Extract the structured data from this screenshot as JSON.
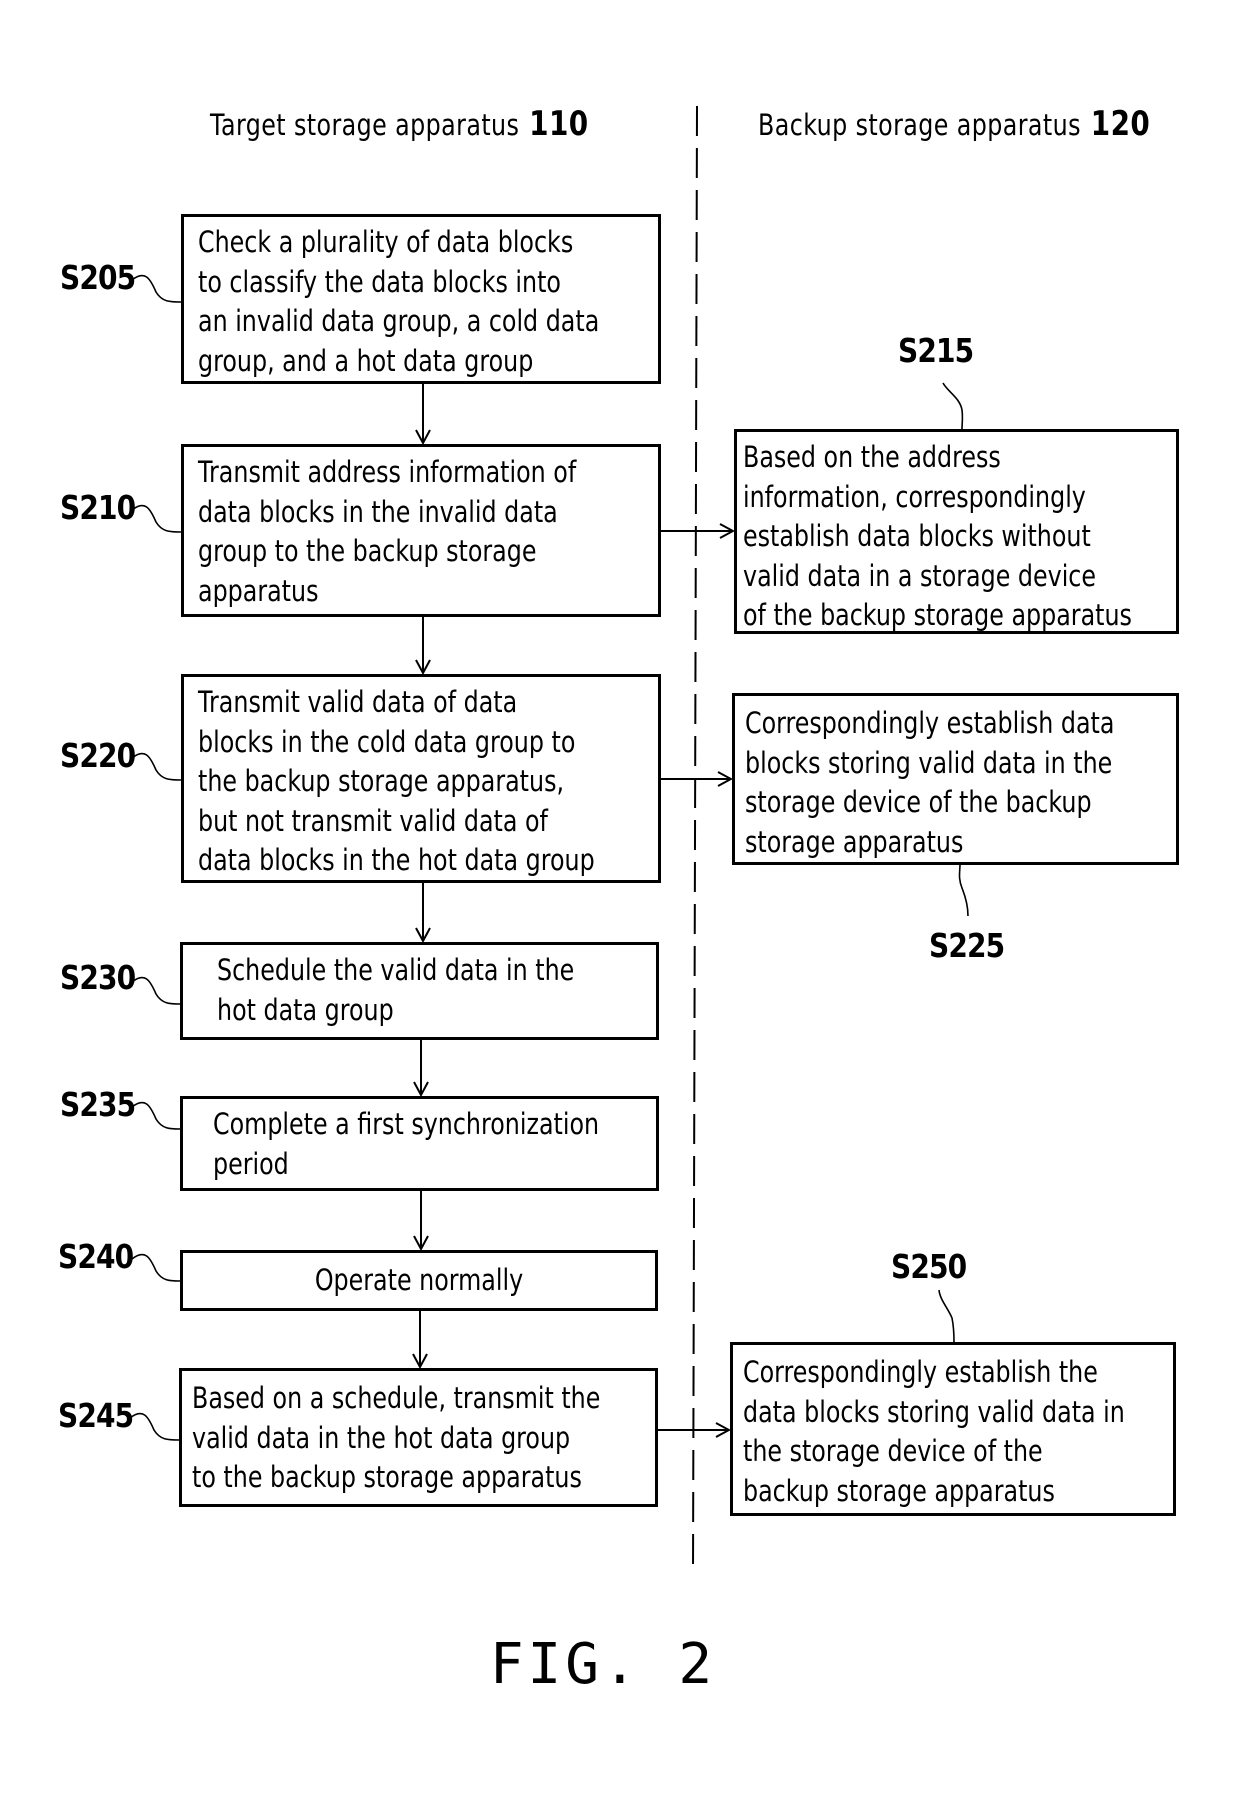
{
  "figure_label": "FIG. 2",
  "columns": [
    {
      "title": "Target storage apparatus",
      "ref": "110"
    },
    {
      "title": "Backup storage apparatus",
      "ref": "120"
    }
  ],
  "steps": {
    "S205": {
      "id": "S205",
      "text": "Check a plurality of data blocks\nto classify the data blocks into\nan invalid data group, a cold data\ngroup, and a hot data group"
    },
    "S210": {
      "id": "S210",
      "text": "Transmit address information of\ndata blocks in the invalid data\ngroup to the backup storage\napparatus"
    },
    "S215": {
      "id": "S215",
      "text": "Based on the address\ninformation, correspondingly\nestablish data blocks without\nvalid data in a storage device\nof the backup storage apparatus"
    },
    "S220": {
      "id": "S220",
      "text": "Transmit valid data of data\nblocks in the cold data group to\nthe backup storage apparatus,\nbut not transmit valid data of\ndata blocks in the hot data group"
    },
    "S225": {
      "id": "S225",
      "text": "Correspondingly establish data\nblocks storing valid data in the\nstorage device of the backup\nstorage apparatus"
    },
    "S230": {
      "id": "S230",
      "text": "Schedule the valid data in the\nhot data group"
    },
    "S235": {
      "id": "S235",
      "text": "Complete a first synchronization\nperiod"
    },
    "S240": {
      "id": "S240",
      "text": "Operate normally"
    },
    "S245": {
      "id": "S245",
      "text": "Based on a schedule, transmit the\nvalid data in the hot data group\nto the backup storage apparatus"
    },
    "S250": {
      "id": "S250",
      "text": "Correspondingly establish the\ndata blocks storing valid data in\nthe storage device of the\nbackup storage apparatus"
    }
  },
  "flow": [
    {
      "from": "S205",
      "to": "S210"
    },
    {
      "from": "S210",
      "to": "S220"
    },
    {
      "from": "S210",
      "to": "S215"
    },
    {
      "from": "S220",
      "to": "S230"
    },
    {
      "from": "S220",
      "to": "S225"
    },
    {
      "from": "S230",
      "to": "S235"
    },
    {
      "from": "S235",
      "to": "S240"
    },
    {
      "from": "S240",
      "to": "S245"
    },
    {
      "from": "S245",
      "to": "S250"
    }
  ]
}
